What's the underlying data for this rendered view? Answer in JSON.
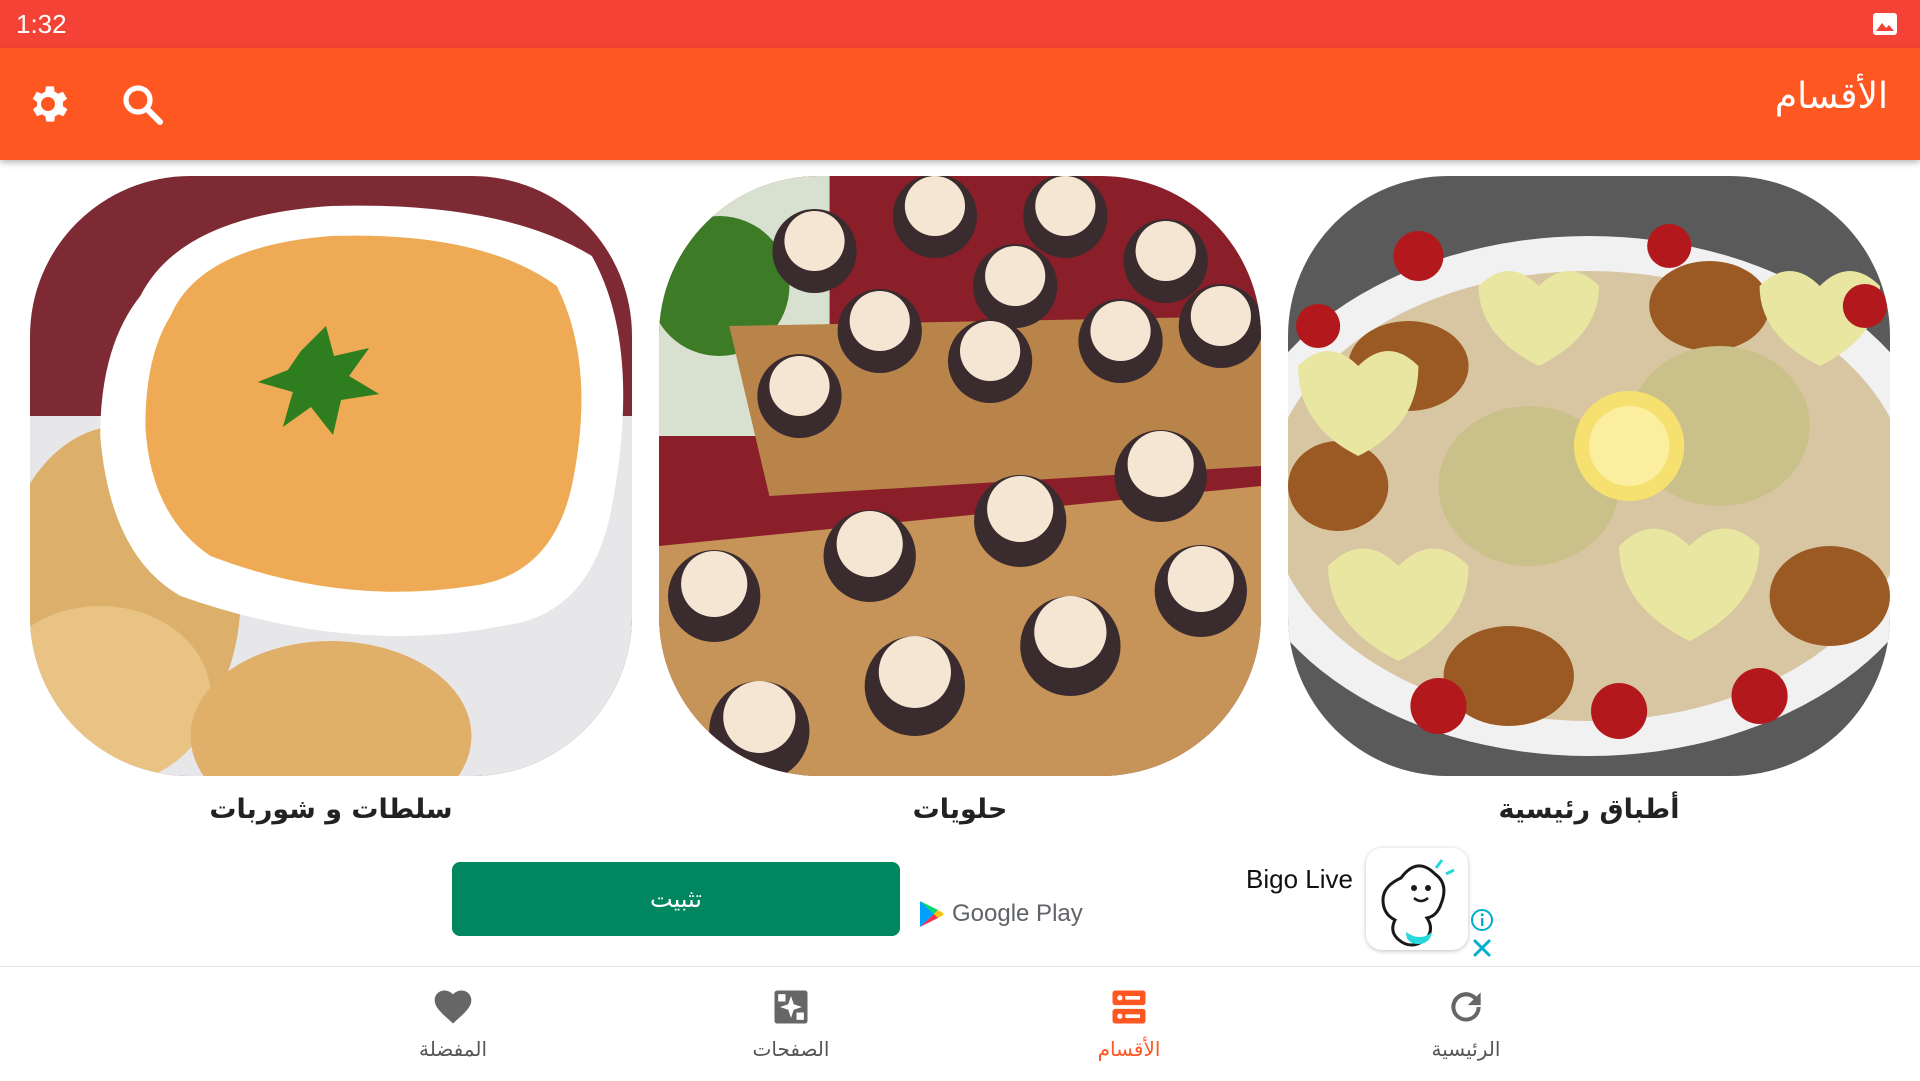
{
  "status_bar": {
    "time": "1:32"
  },
  "app_bar": {
    "title": "الأقسام"
  },
  "categories": [
    {
      "label": "سلطات و شوربات",
      "image_icon": "soup-bowl-photo"
    },
    {
      "label": "حلويات",
      "image_icon": "chocolate-cookies-photo"
    },
    {
      "label": "أطباق رئيسية",
      "image_icon": "chicken-platter-photo"
    }
  ],
  "ad": {
    "install_label": "تثبيت",
    "store_label": "Google Play",
    "app_name": "Bigo Live"
  },
  "bottom_nav": {
    "items": [
      {
        "label": "المفضلة",
        "icon": "heart-icon"
      },
      {
        "label": "الصفحات",
        "icon": "pages-icon"
      },
      {
        "label": "الأقسام",
        "icon": "categories-icon",
        "active": true
      },
      {
        "label": "الرئيسية",
        "icon": "refresh-icon"
      }
    ]
  },
  "colors": {
    "status_bar": "#f44336",
    "app_bar": "#ff5722",
    "accent": "#ff5722",
    "install_button": "#01875f"
  }
}
